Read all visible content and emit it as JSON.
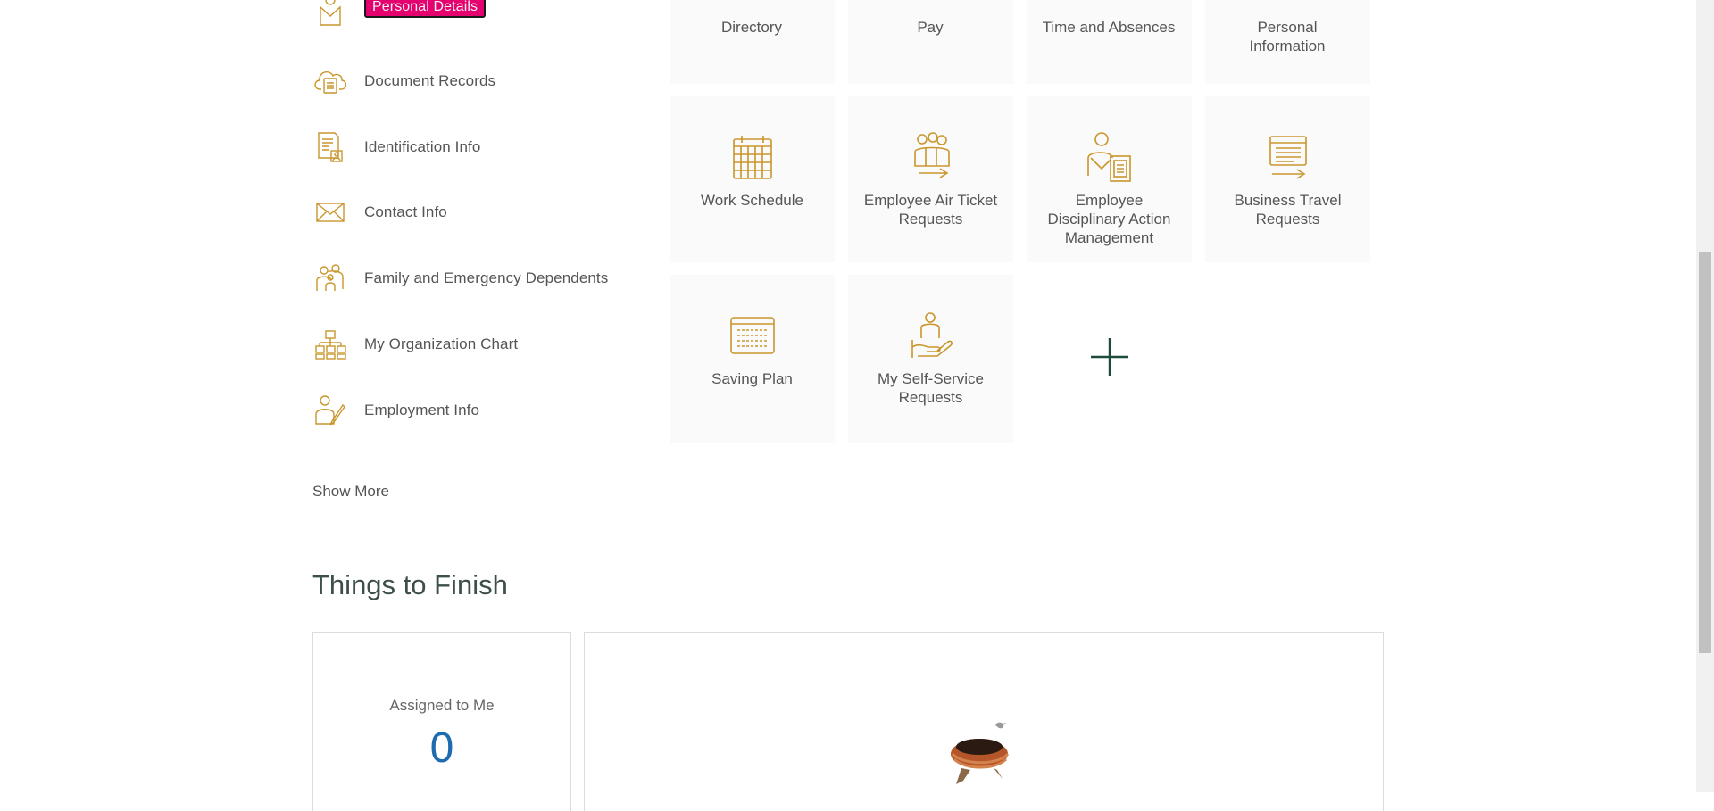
{
  "quick_actions": [
    {
      "label": "Personal Details",
      "icon": "person-icon"
    },
    {
      "label": "Document Records",
      "icon": "cloud-document-icon"
    },
    {
      "label": "Identification Info",
      "icon": "id-card-icon"
    },
    {
      "label": "Contact Info",
      "icon": "envelope-icon"
    },
    {
      "label": "Family and Emergency Dependents",
      "icon": "family-icon"
    },
    {
      "label": "My Organization Chart",
      "icon": "org-chart-icon"
    },
    {
      "label": "Employment Info",
      "icon": "person-pen-icon"
    }
  ],
  "show_more": "Show More",
  "apps": {
    "row1": [
      {
        "label": "Directory"
      },
      {
        "label": "Pay"
      },
      {
        "label": "Time and Absences"
      },
      {
        "label": "Personal Information"
      }
    ],
    "row2": [
      {
        "label": "Work Schedule",
        "icon": "calendar-icon"
      },
      {
        "label": "Employee Air Ticket Requests",
        "icon": "group-arrow-icon"
      },
      {
        "label": "Employee Disciplinary Action Management",
        "icon": "person-document-icon"
      },
      {
        "label": "Business Travel Requests",
        "icon": "list-arrow-icon"
      }
    ],
    "row3": [
      {
        "label": "Saving Plan",
        "icon": "ledger-icon"
      },
      {
        "label": "My Self-Service Requests",
        "icon": "person-hand-icon"
      }
    ],
    "add_icon": "plus-icon"
  },
  "things_to_finish": {
    "title": "Things to Finish",
    "assigned_label": "Assigned to Me",
    "assigned_count": "0",
    "empty_icon": "empty-nest-icon"
  },
  "colors": {
    "icon_gold": "#c9962c",
    "highlight": "#e5006f",
    "count_blue": "#1f6bb0",
    "title_green": "#3d4f48",
    "plus_green": "#1e4a3a"
  }
}
